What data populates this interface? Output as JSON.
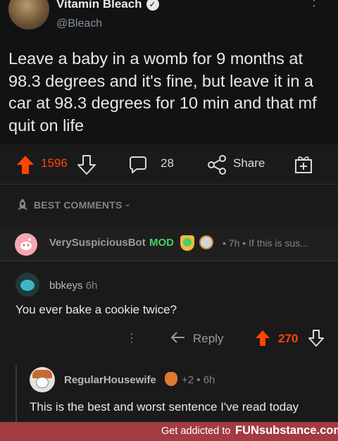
{
  "tweet": {
    "name": "Vitamin Bleach",
    "handle": "@Bleach",
    "text": "Leave a baby in a womb for 9 months at 98.3 degrees and it's fine, but leave it in a car at 98.3 degrees for 10 min and that mf quit on life"
  },
  "post_actions": {
    "upvotes": "1596",
    "comments": "28",
    "share": "Share"
  },
  "sort": {
    "label": "BEST COMMENTS"
  },
  "bot_comment": {
    "author": "VerySuspiciousBot",
    "badge": "MOD",
    "meta": "• 7h • If this is sus..."
  },
  "comment": {
    "author": "bbkeys",
    "time": "6h",
    "text": "You ever bake a cookie twice?",
    "reply": "Reply",
    "votes": "270"
  },
  "reply_comment": {
    "author": "RegularHousewife",
    "meta": "+2 • 6h",
    "text": "This is the best and worst sentence I've read today"
  },
  "footer": {
    "text": "Get addicted to",
    "brand": "FUNsubstance.com"
  },
  "colors": {
    "upvote": "#ff4500",
    "mod": "#46d160",
    "footer_bg": "#a23c41"
  }
}
